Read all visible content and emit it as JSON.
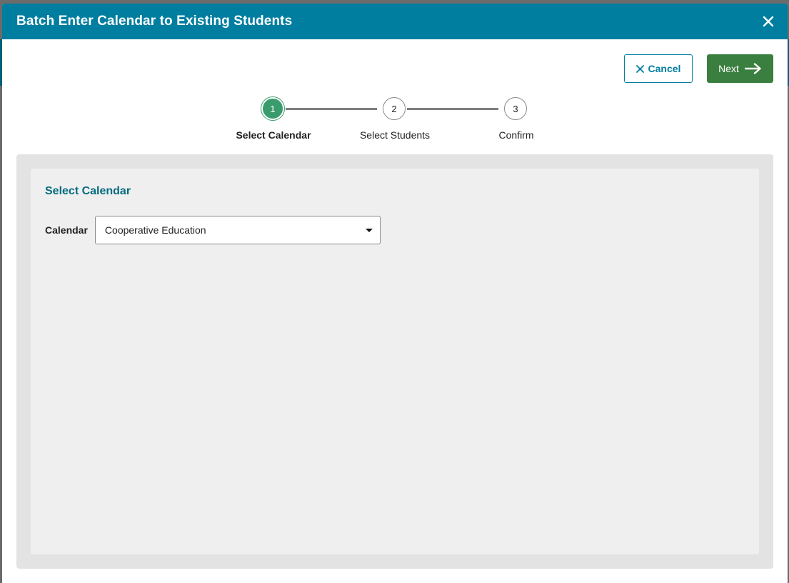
{
  "dialog": {
    "title": "Batch Enter Calendar to Existing Students",
    "close_icon": "close-icon"
  },
  "actions": {
    "cancel_label": "Cancel",
    "cancel_icon": "x-icon",
    "next_label": "Next",
    "next_icon": "arrow-right-icon"
  },
  "stepper": {
    "steps": [
      {
        "number": "1",
        "label": "Select Calendar",
        "active": true
      },
      {
        "number": "2",
        "label": "Select Students",
        "active": false
      },
      {
        "number": "3",
        "label": "Confirm",
        "active": false
      }
    ]
  },
  "form": {
    "section_title": "Select Calendar",
    "calendar_label": "Calendar",
    "calendar_value": "Cooperative Education"
  },
  "colors": {
    "header": "#007ea0",
    "primary_button": "#3a7f3f",
    "active_step": "#3a9c6c",
    "section_title": "#046b7f"
  }
}
